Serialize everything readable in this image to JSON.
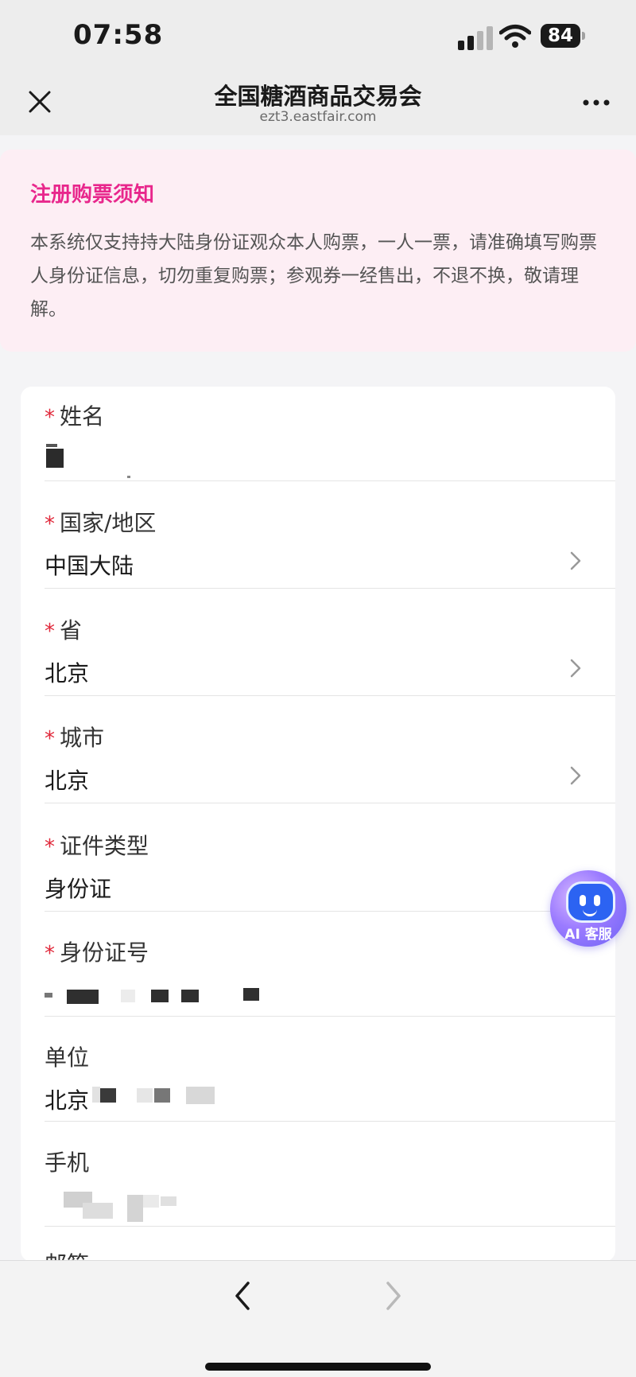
{
  "status_bar": {
    "time": "07:58",
    "battery_level": "84",
    "icons": [
      "signal-icon",
      "wifi-icon",
      "battery-icon"
    ]
  },
  "nav": {
    "title": "全国糖酒商品交易会",
    "url": "ezt3.eastfair.com",
    "icons": [
      "close-icon",
      "more-icon"
    ]
  },
  "notice": {
    "title": "注册购票须知",
    "body": "本系统仅支持持大陆身份证观众本人购票，一人一票，请准确填写购票人身份证信息，切勿重复购票；参观券一经售出，不退不换，敬请理解。"
  },
  "form": {
    "required_mark": "*",
    "fields": [
      {
        "label": "姓名",
        "value": ""
      },
      {
        "label": "国家/地区",
        "value": "中国大陆"
      },
      {
        "label": "省",
        "value": "北京"
      },
      {
        "label": "城市",
        "value": "北京"
      },
      {
        "label": "证件类型",
        "value": "身份证"
      },
      {
        "label": "身份证号",
        "value": ""
      },
      {
        "label": "单位",
        "value": "北京"
      },
      {
        "label": "手机",
        "value": ""
      },
      {
        "label": "邮箱",
        "value": ""
      }
    ]
  },
  "ai_service": {
    "label": "AI 客服",
    "icon": "robot-icon"
  },
  "colors": {
    "accent": "#e8278c",
    "notice_bg": "#fdeef4",
    "required": "#e0283a",
    "page_bg": "#f4f4f6"
  }
}
